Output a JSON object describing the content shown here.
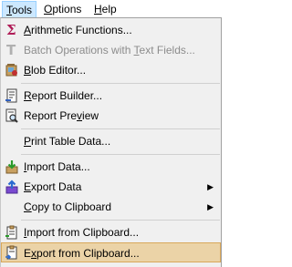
{
  "menubar": {
    "items": [
      {
        "label": "Tools",
        "mnemonic": "T",
        "rest": "ools"
      },
      {
        "label": "Options",
        "mnemonic": "O",
        "rest": "ptions"
      },
      {
        "label": "Help",
        "mnemonic": "H",
        "rest": "elp"
      }
    ]
  },
  "menu": {
    "arithmetic": {
      "icon": "sigma-icon",
      "pre": "",
      "mn": "A",
      "post": "rithmetic Functions..."
    },
    "batch": {
      "icon": "text-t-icon",
      "pre": "Batch Operations with ",
      "mn": "T",
      "post": "ext Fields..."
    },
    "blob": {
      "icon": "blob-editor-icon",
      "pre": "",
      "mn": "B",
      "post": "lob Editor..."
    },
    "report_builder": {
      "icon": "report-builder-icon",
      "pre": "",
      "mn": "R",
      "post": "eport Builder..."
    },
    "report_preview": {
      "icon": "report-preview-icon",
      "pre": "Report Pre",
      "mn": "v",
      "post": "iew"
    },
    "print_table": {
      "icon": "",
      "pre": "",
      "mn": "P",
      "post": "rint Table Data..."
    },
    "import_data": {
      "icon": "import-data-icon",
      "pre": "",
      "mn": "I",
      "post": "mport Data..."
    },
    "export_data": {
      "icon": "export-data-icon",
      "pre": "",
      "mn": "E",
      "post": "xport Data"
    },
    "copy_clipboard": {
      "icon": "",
      "pre": "",
      "mn": "C",
      "post": "opy to Clipboard"
    },
    "import_clipboard": {
      "icon": "import-clipboard-icon",
      "pre": "",
      "mn": "I",
      "post": "mport from Clipboard..."
    },
    "export_clipboard": {
      "icon": "export-clipboard-icon",
      "pre": "E",
      "mn": "x",
      "post": "port from Clipboard..."
    },
    "submenu_arrow": "▶"
  },
  "colors": {
    "hover_bg": "#ebd3a7",
    "hover_border": "#d9a85a",
    "menu_bg": "#f0f0f0",
    "disabled_text": "#8c8c8c"
  }
}
